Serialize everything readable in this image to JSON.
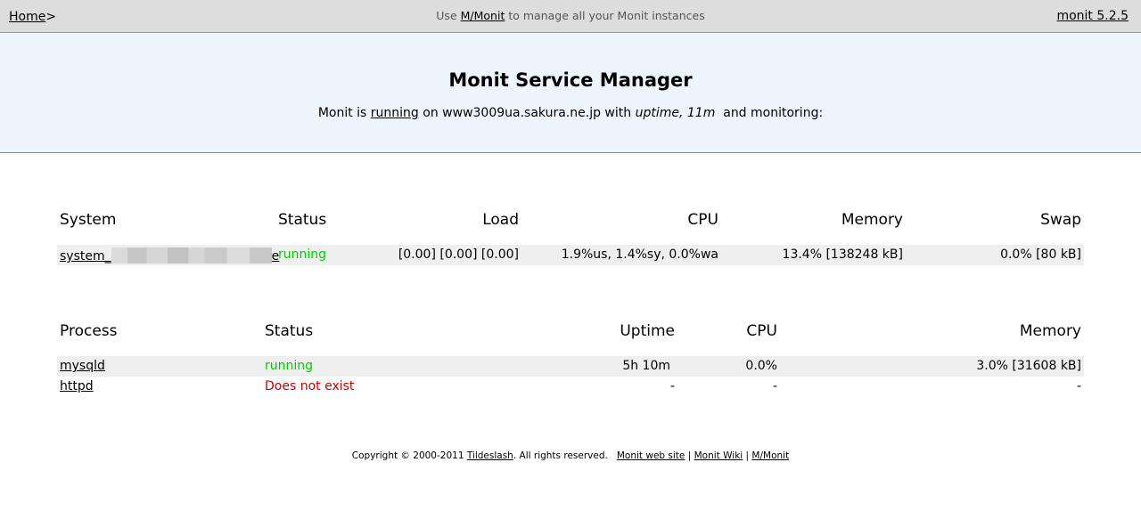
{
  "topbar": {
    "home_link": "Home",
    "home_suffix": ">",
    "center_prefix": "Use",
    "mmonit_link": "M/Monit",
    "center_suffix": "to manage all your Monit instances",
    "version_link": "monit 5.2.5"
  },
  "banner": {
    "title": "Monit Service Manager",
    "monit_is": "Monit is",
    "running_link": "running",
    "on_host": "on www3009ua.sakura.ne.jp with",
    "uptime_label": "uptime,",
    "uptime_value": "11m",
    "and_monitoring": "and monitoring:"
  },
  "system_table": {
    "headers": [
      "System",
      "Status",
      "Load",
      "CPU",
      "Memory",
      "Swap"
    ],
    "rows": [
      {
        "name": "system_",
        "name_tail": "e",
        "status": "running",
        "load": "[0.00] [0.00] [0.00]",
        "cpu": "1.9%us, 1.4%sy, 0.0%wa",
        "memory": "13.4% [138248 kB]",
        "swap": "0.0% [80 kB]"
      }
    ]
  },
  "process_table": {
    "headers": [
      "Process",
      "Status",
      "Uptime",
      "CPU",
      "Memory"
    ],
    "rows": [
      {
        "name": "mysqld",
        "status": "running",
        "uptime": "5h 10m",
        "cpu": "0.0%",
        "memory": "3.0% [31608 kB]"
      },
      {
        "name": "httpd",
        "status": "Does not exist",
        "uptime": "-",
        "cpu": "-",
        "memory": "-"
      }
    ]
  },
  "footer": {
    "copyright": "Copyright © 2000-2011",
    "tildeslash_link": "Tildeslash",
    "rights": ". All rights reserved.",
    "website_link": "Monit web site",
    "sep1": "|",
    "wiki_link": "Monit Wiki",
    "sep2": "|",
    "mmonit_link": "M/Monit"
  },
  "colors": {
    "status_ok": "#00cc00",
    "status_error": "#cc0000",
    "banner_bg": "#eef5fd",
    "topbar_bg": "#dddddd"
  }
}
